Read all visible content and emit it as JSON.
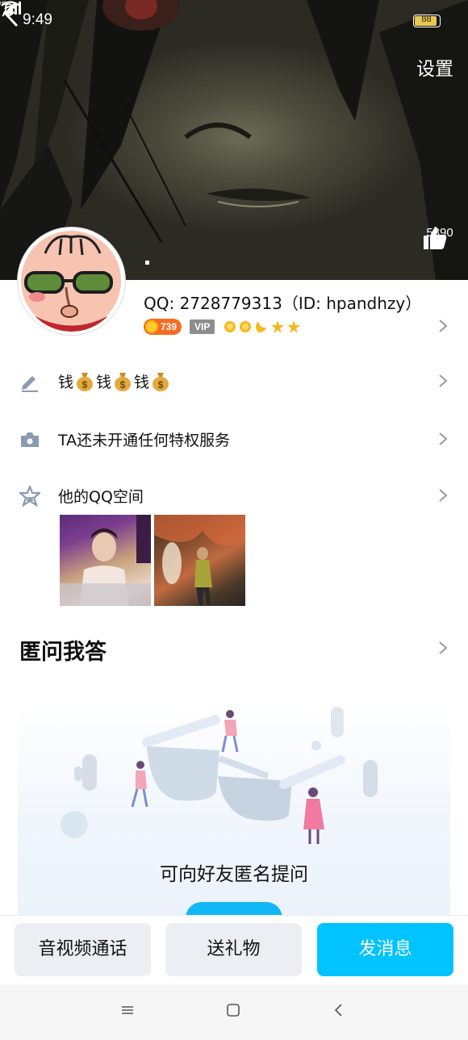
{
  "status_bar": {
    "time": "9:49",
    "battery": "88"
  },
  "header": {
    "settings_label": "设置",
    "like_count": "5890"
  },
  "profile": {
    "qq_line": "QQ: 2728779313（ID: hpandhzy）",
    "level_value": "739",
    "vip_label": "VIP"
  },
  "rows": {
    "signature": {
      "parts": [
        "钱",
        "钱",
        "钱"
      ]
    },
    "privilege": {
      "label": "TA还未开通任何特权服务"
    },
    "qzone": {
      "label": "他的QQ空间"
    }
  },
  "qa": {
    "title": "匿问我答",
    "prompt": "可向好友匿名提问"
  },
  "actions": {
    "call": "音视频通话",
    "gift": "送礼物",
    "message": "发消息"
  },
  "colors": {
    "accent": "#00c3ff",
    "level_badge": "#f46d22",
    "vip_badge": "#8d8d8d"
  }
}
